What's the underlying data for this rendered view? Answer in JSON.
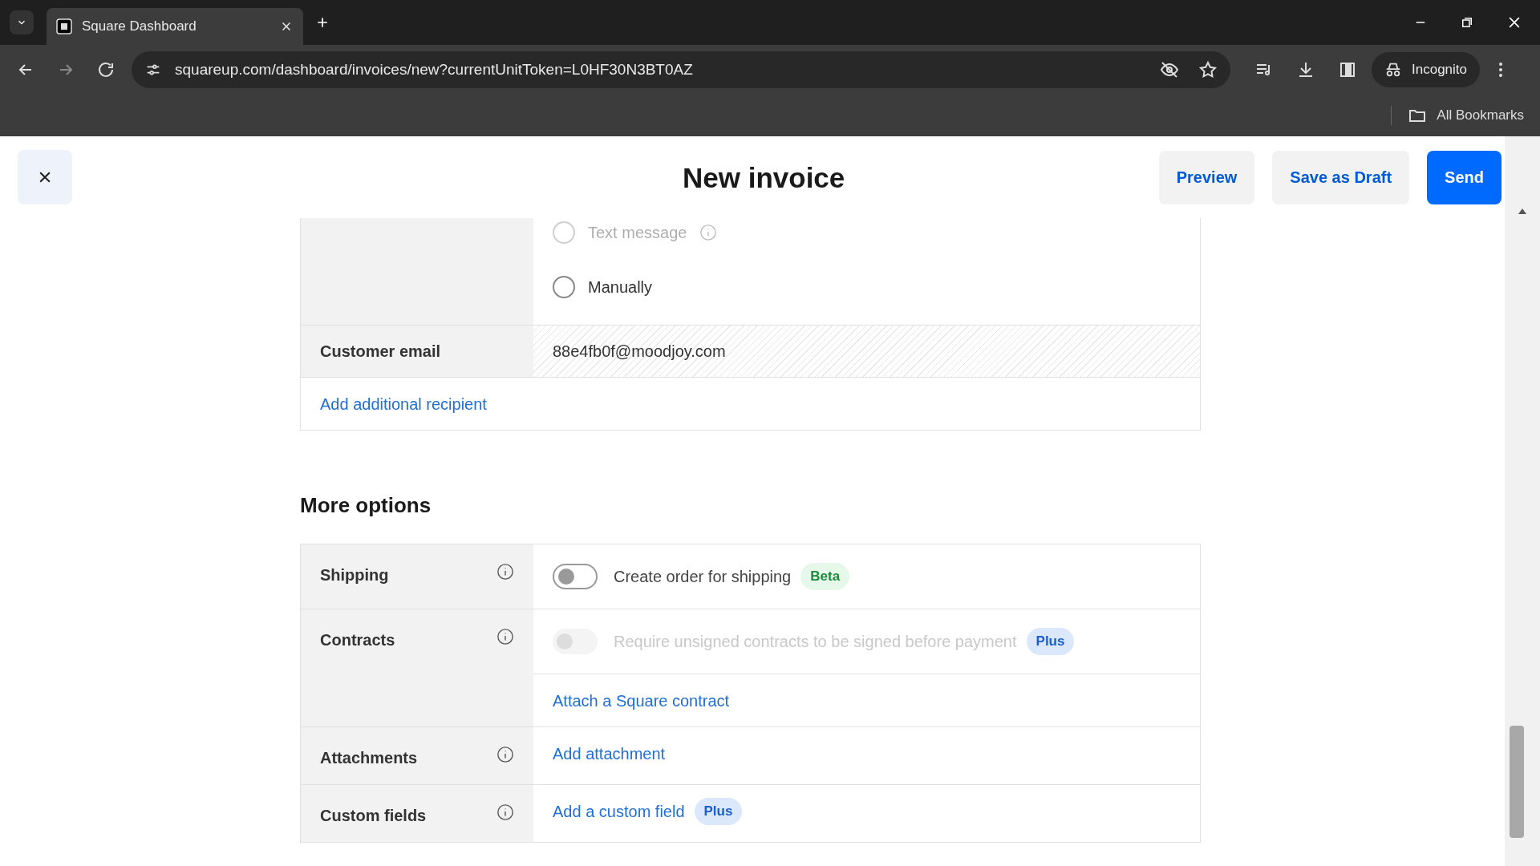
{
  "browser": {
    "tab_title": "Square Dashboard",
    "url": "squareup.com/dashboard/invoices/new?currentUnitToken=L0HF30N3BT0AZ",
    "profile": "Incognito",
    "bookmarks": "All Bookmarks"
  },
  "header": {
    "title": "New invoice",
    "buttons": [
      {
        "label": "Preview",
        "kind": "secondary"
      },
      {
        "label": "Save as Draft",
        "kind": "secondary"
      },
      {
        "label": "Send",
        "kind": "primary"
      }
    ]
  },
  "delivery_options": [
    {
      "label": "Text message",
      "selected": false,
      "disabled": true,
      "info": true
    },
    {
      "label": "Manually",
      "selected": false,
      "disabled": false,
      "info": false
    }
  ],
  "customer_email": {
    "label": "Customer email",
    "value": "88e4fb0f@moodjoy.com"
  },
  "add_recipient": "Add additional recipient",
  "more_options": {
    "title": "More options",
    "rows": [
      {
        "label": "Shipping",
        "items": [
          {
            "kind": "toggle",
            "label": "Create order for shipping",
            "on": false,
            "disabled": false,
            "badge": {
              "text": "Beta",
              "kind": "beta"
            }
          }
        ]
      },
      {
        "label": "Contracts",
        "items": [
          {
            "kind": "toggle",
            "label": "Require unsigned contracts to be signed before payment",
            "on": false,
            "disabled": true,
            "badge": {
              "text": "Plus",
              "kind": "plus"
            }
          },
          {
            "kind": "link",
            "label": "Attach a Square contract"
          }
        ]
      },
      {
        "label": "Attachments",
        "items": [
          {
            "kind": "link",
            "label": "Add attachment"
          }
        ]
      },
      {
        "label": "Custom fields",
        "items": [
          {
            "kind": "link",
            "label": "Add a custom field",
            "badge": {
              "text": "Plus",
              "kind": "plus"
            }
          }
        ]
      }
    ]
  }
}
